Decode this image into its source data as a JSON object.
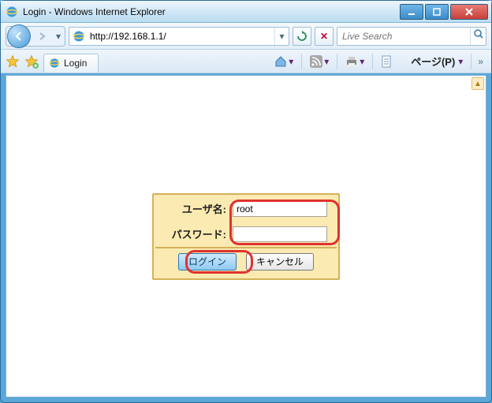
{
  "window": {
    "title": "Login - Windows Internet Explorer"
  },
  "nav": {
    "url": "http://192.168.1.1/",
    "search_placeholder": "Live Search"
  },
  "tab": {
    "label": "Login"
  },
  "cmd": {
    "pages_label": "ページ(P)"
  },
  "login": {
    "username_label": "ユーザ名:",
    "password_label": "パスワード:",
    "username_value": "root",
    "password_value": "",
    "login_btn": "ログイン",
    "cancel_btn": "キャンセル"
  }
}
